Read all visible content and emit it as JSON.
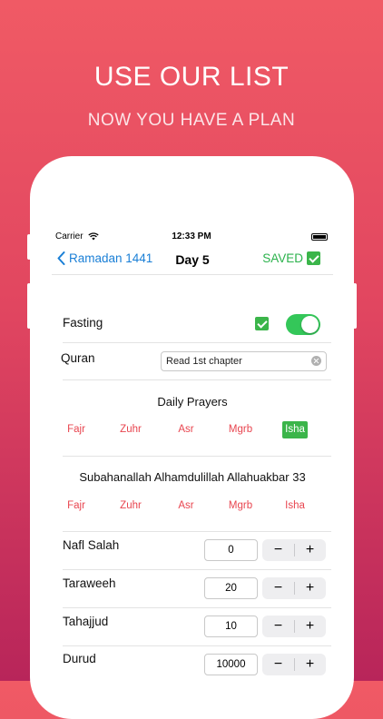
{
  "promo": {
    "title": "USE OUR LIST",
    "subtitle": "NOW YOU HAVE A PLAN"
  },
  "status_bar": {
    "carrier": "Carrier",
    "time": "12:33 PM"
  },
  "navbar": {
    "back_label": "Ramadan 1441",
    "title": "Day 5",
    "saved_label": "SAVED"
  },
  "fasting": {
    "label": "Fasting",
    "checked": true,
    "toggle_on": true
  },
  "quran": {
    "label": "Quran",
    "value": "Read 1st chapter"
  },
  "daily_prayers": {
    "title": "Daily Prayers",
    "items": [
      "Fajr",
      "Zuhr",
      "Asr",
      "Mgrb",
      "Isha"
    ],
    "selected": "Isha"
  },
  "dhikr": {
    "title": "Subahanallah Alhamdulillah Allahuakbar 33",
    "items": [
      "Fajr",
      "Zuhr",
      "Asr",
      "Mgrb",
      "Isha"
    ]
  },
  "counters": [
    {
      "label": "Nafl Salah",
      "value": "0"
    },
    {
      "label": "Taraweeh",
      "value": "20"
    },
    {
      "label": "Tahajjud",
      "value": "10"
    },
    {
      "label": "Durud",
      "value": "10000"
    }
  ],
  "stepper": {
    "minus": "−",
    "plus": "+"
  },
  "colors": {
    "accent_blue": "#1a7fd6",
    "saved_green": "#2bb24c",
    "prayer_red": "#e8454f",
    "toggle_green": "#34c759",
    "background_top": "#f05a65",
    "background_bottom": "#b8255a"
  }
}
